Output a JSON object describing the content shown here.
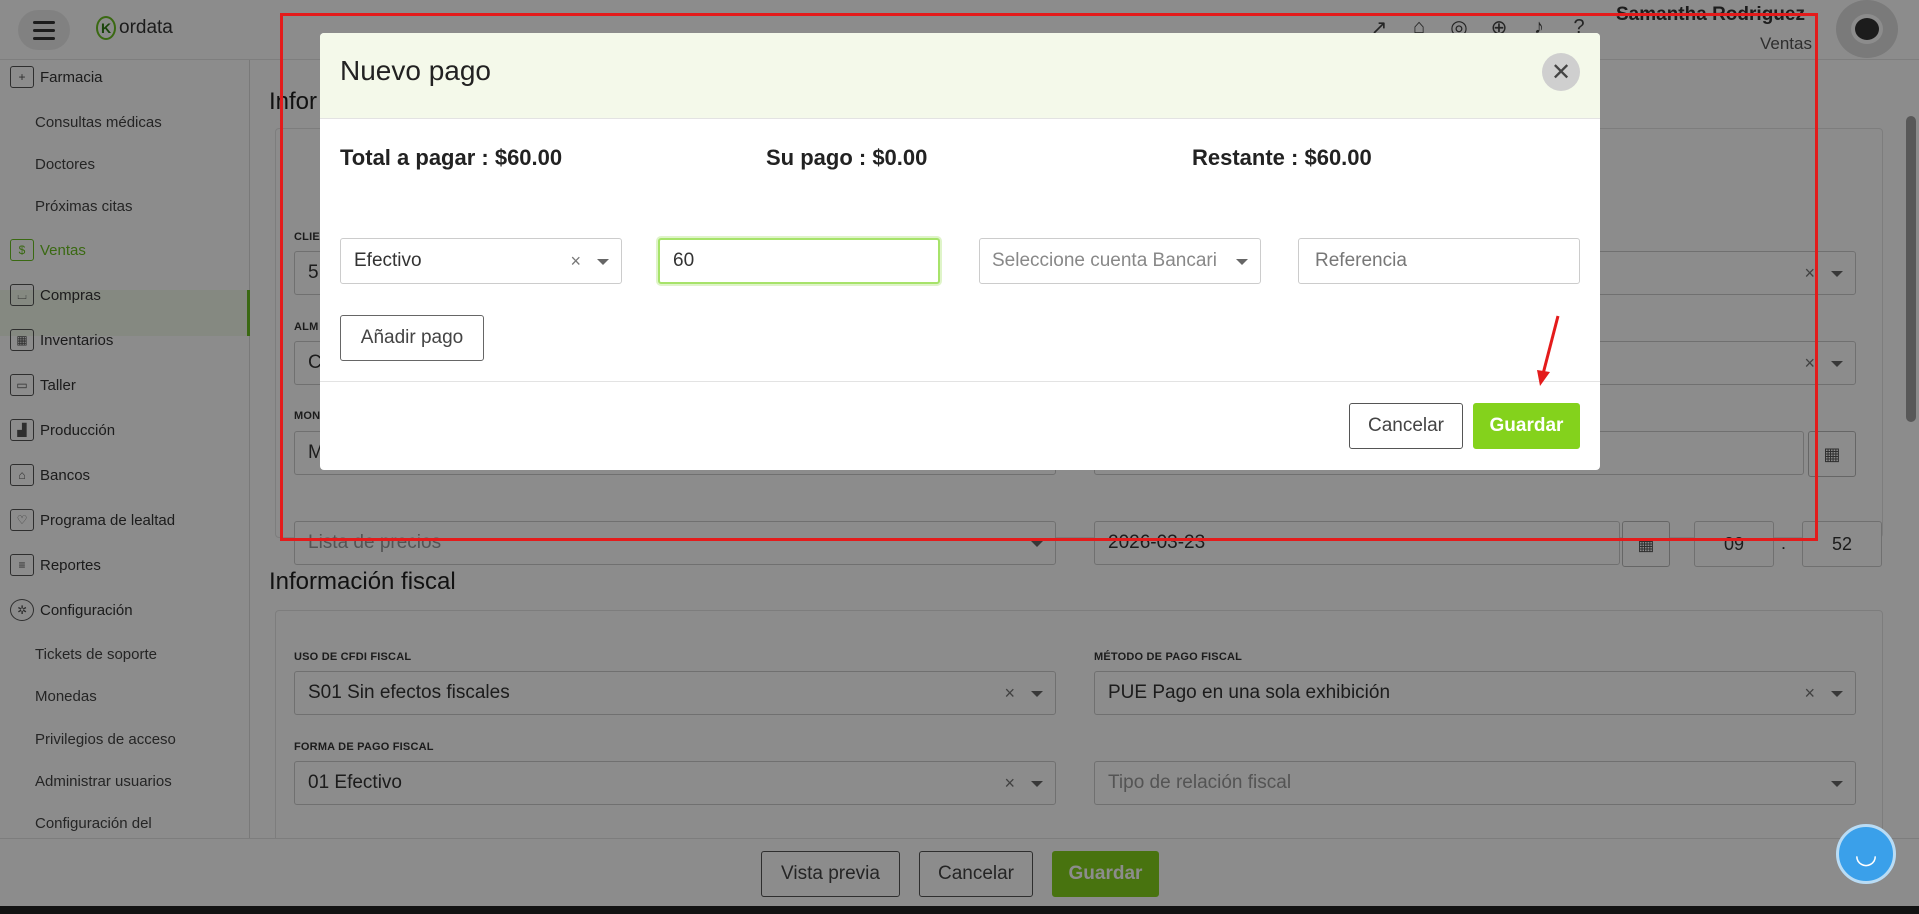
{
  "topbar": {
    "brand": "ordata",
    "brand_mark": "K",
    "user_name": "Samantha Rodriguez",
    "user_role": "Ventas",
    "icons": [
      "external-link-icon",
      "gift-icon",
      "support-icon",
      "plus-circle-icon",
      "bell-icon",
      "help-icon"
    ]
  },
  "sidebar": {
    "items": [
      {
        "label": "Farmacia",
        "icon": "pharmacy-icon",
        "type": "section"
      },
      {
        "label": "Consultas médicas",
        "type": "sub"
      },
      {
        "label": "Doctores",
        "type": "sub"
      },
      {
        "label": "Próximas citas",
        "type": "sub"
      },
      {
        "label": "Ventas",
        "icon": "sales-icon",
        "type": "section",
        "active": true
      },
      {
        "label": "Compras",
        "icon": "cart-icon",
        "type": "section"
      },
      {
        "label": "Inventarios",
        "icon": "boxes-icon",
        "type": "section"
      },
      {
        "label": "Taller",
        "icon": "car-icon",
        "type": "section"
      },
      {
        "label": "Producción",
        "icon": "production-icon",
        "type": "section"
      },
      {
        "label": "Bancos",
        "icon": "bank-icon",
        "type": "section"
      },
      {
        "label": "Programa de lealtad",
        "icon": "loyalty-icon",
        "type": "section"
      },
      {
        "label": "Reportes",
        "icon": "report-icon",
        "type": "section"
      },
      {
        "label": "Configuración",
        "icon": "gear-icon",
        "type": "section"
      },
      {
        "label": "Tickets de soporte",
        "type": "sub"
      },
      {
        "label": "Monedas",
        "type": "sub"
      },
      {
        "label": "Privilegios de acceso",
        "type": "sub"
      },
      {
        "label": "Administrar usuarios",
        "type": "sub"
      },
      {
        "label": "Configuración del",
        "type": "sub"
      }
    ]
  },
  "main": {
    "section1_title_partial": "Infor",
    "label_cliente_partial": "CLIE",
    "label_almacen_partial": "ALM",
    "label_moneda_partial": "MON",
    "cliente_value_partial": "5",
    "almacen_value_partial": "C",
    "moneda_value_partial": "M",
    "lista_precios_placeholder": "Lista de precios",
    "fecha_value": "2026-03-23",
    "hora": "09",
    "minuto": "52",
    "time_separator": ":",
    "fiscal_title": "Información fiscal",
    "uso_cfdi_label": "USO DE CFDI FISCAL",
    "uso_cfdi_value": "S01 Sin efectos fiscales",
    "metodo_pago_label": "MÉTODO DE PAGO FISCAL",
    "metodo_pago_value": "PUE Pago en una sola exhibición",
    "forma_pago_label": "FORMA DE PAGO FISCAL",
    "forma_pago_value": "01 Efectivo",
    "tipo_relacion_placeholder": "Tipo de relación fiscal",
    "clear_glyph": "×"
  },
  "bottom_bar": {
    "preview_label": "Vista previa",
    "cancel_label": "Cancelar",
    "save_label": "Guardar"
  },
  "modal": {
    "title": "Nuevo pago",
    "close_glyph": "✕",
    "total": "Total a pagar : $60.00",
    "su_pago": "Su pago : $0.00",
    "restante": "Restante : $60.00",
    "payment_method": "Efectivo",
    "amount": "60",
    "bank_account_placeholder": "Seleccione cuenta Bancari",
    "reference_placeholder": "Referencia",
    "add_payment_label": "Añadir pago",
    "cancel_label": "Cancelar",
    "save_label": "Guardar"
  },
  "colors": {
    "accent_green": "#84d21c",
    "annotation_red": "#e41b1b",
    "modal_header_bg": "#f4f9ea"
  }
}
